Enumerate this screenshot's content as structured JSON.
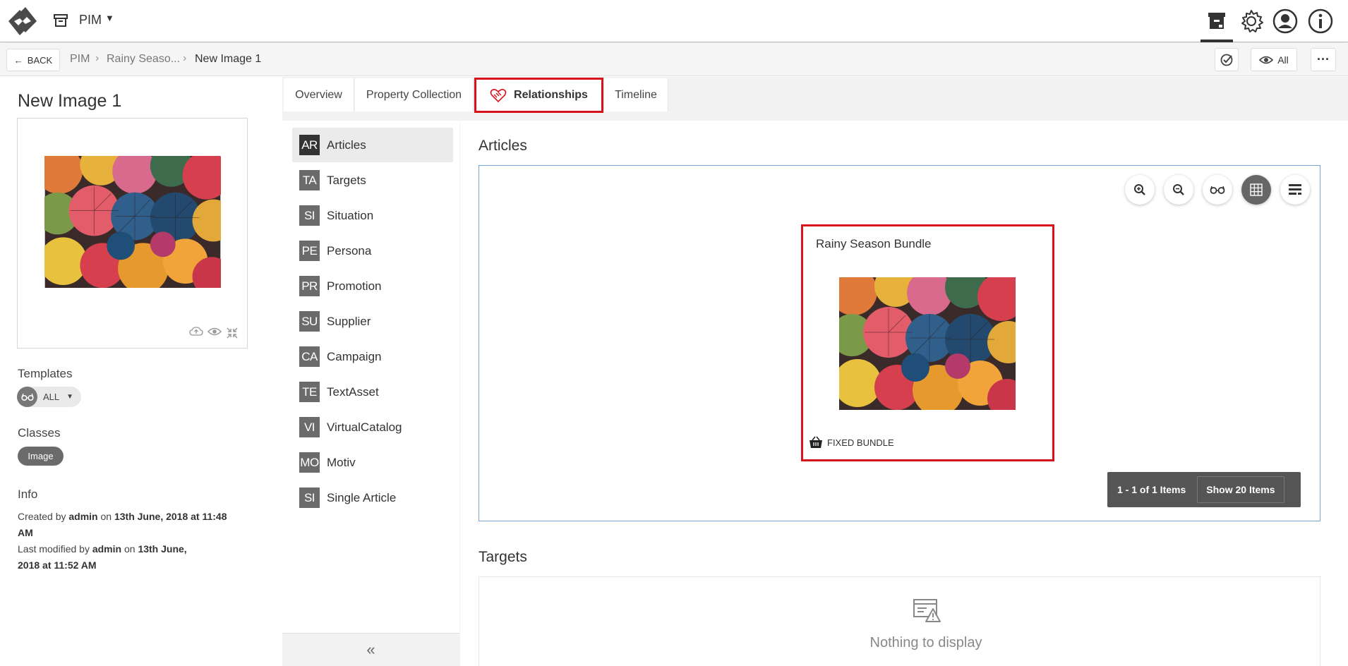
{
  "header": {
    "app_name": "PIM",
    "icons": [
      "logo-icon",
      "archive-icon",
      "workspace-icon",
      "settings-gear-icon",
      "user-account-icon",
      "info-icon"
    ]
  },
  "breadcrumb": {
    "back_label": "BACK",
    "items": [
      "PIM",
      "Rainy Seaso...",
      "New Image 1"
    ],
    "view_filter_label": "All"
  },
  "entity": {
    "title": "New Image 1",
    "templates_label": "Templates",
    "template_value": "ALL",
    "classes_label": "Classes",
    "class_value": "Image",
    "info_label": "Info",
    "created_prefix": "Created by",
    "created_user": "admin",
    "created_on": "on",
    "created_date": "13th June, 2018 at 11:48 AM",
    "modified_prefix": "Last modified by",
    "modified_user": "admin",
    "modified_on": "on",
    "modified_date": "13th June, 2018 at 11:52 AM"
  },
  "tabs": [
    {
      "label": "Overview"
    },
    {
      "label": "Property Collection"
    },
    {
      "label": "Relationships"
    },
    {
      "label": "Timeline"
    }
  ],
  "relationships": [
    {
      "code": "AR",
      "label": "Articles"
    },
    {
      "code": "TA",
      "label": "Targets"
    },
    {
      "code": "SI",
      "label": "Situation"
    },
    {
      "code": "PE",
      "label": "Persona"
    },
    {
      "code": "PR",
      "label": "Promotion"
    },
    {
      "code": "SU",
      "label": "Supplier"
    },
    {
      "code": "CA",
      "label": "Campaign"
    },
    {
      "code": "TE",
      "label": "TextAsset"
    },
    {
      "code": "VI",
      "label": "VirtualCatalog"
    },
    {
      "code": "MO",
      "label": "Motiv"
    },
    {
      "code": "SI",
      "label": "Single Article"
    }
  ],
  "collapse_glyph": "«",
  "articles": {
    "title": "Articles",
    "card_title": "Rainy Season Bundle",
    "card_tag": "FIXED BUNDLE",
    "pager_count": "1 - 1 of 1 Items",
    "pager_show": "Show 20 Items"
  },
  "targets": {
    "title": "Targets",
    "empty_text": "Nothing to display"
  },
  "colors": {
    "highlight_red": "#d8121b",
    "badge_gray": "#6b6b6b",
    "panel_border_blue": "#7aa4d6"
  }
}
